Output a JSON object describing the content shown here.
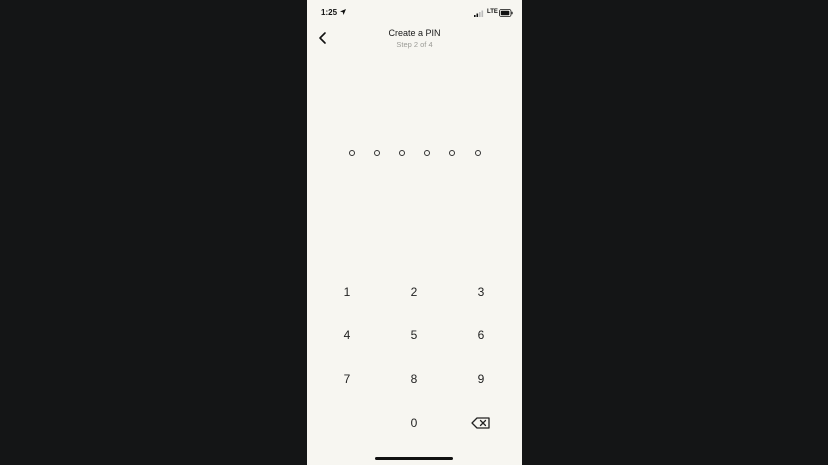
{
  "status_bar": {
    "time": "1:25",
    "location_icon": "location-arrow-icon",
    "signal_icon": "signal-bars-icon",
    "network": "LTE",
    "battery_icon": "battery-icon"
  },
  "header": {
    "back_icon": "chevron-left-icon",
    "title": "Create a PIN",
    "subtitle": "Step 2 of 4"
  },
  "pin": {
    "length": 6,
    "entered": 0
  },
  "keypad": {
    "keys": [
      "1",
      "2",
      "3",
      "4",
      "5",
      "6",
      "7",
      "8",
      "9",
      "0"
    ],
    "backspace_icon": "backspace-icon"
  },
  "colors": {
    "background": "#f7f6f1",
    "outer_background": "#141516",
    "text": "#1a1a1a",
    "subtitle": "#9b9b96"
  }
}
